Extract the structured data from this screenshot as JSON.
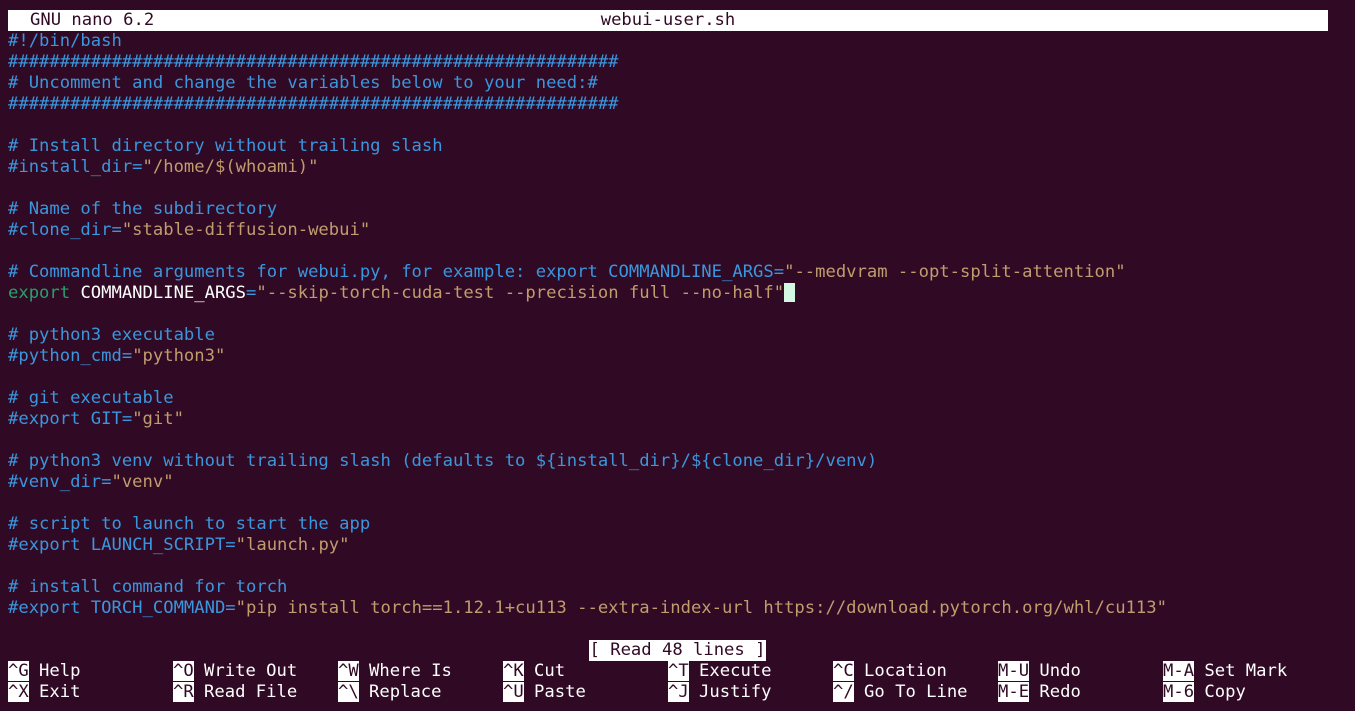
{
  "titlebar": {
    "app": "GNU nano 6.2",
    "filename": "webui-user.sh"
  },
  "editor": {
    "lines": [
      [
        {
          "t": "#!/bin/bash",
          "c": "cm"
        }
      ],
      [
        {
          "t": "###########################################################",
          "c": "cm"
        }
      ],
      [
        {
          "t": "# Uncomment and change the variables below to your need:#",
          "c": "cm"
        }
      ],
      [
        {
          "t": "###########################################################",
          "c": "cm"
        }
      ],
      [],
      [
        {
          "t": "# Install directory without trailing slash",
          "c": "cm"
        }
      ],
      [
        {
          "t": "#install_dir=",
          "c": "cm"
        },
        {
          "t": "\"/home/$(whoami)\"",
          "c": "str"
        }
      ],
      [],
      [
        {
          "t": "# Name of the subdirectory",
          "c": "cm"
        }
      ],
      [
        {
          "t": "#clone_dir=",
          "c": "cm"
        },
        {
          "t": "\"stable-diffusion-webui\"",
          "c": "str"
        }
      ],
      [],
      [
        {
          "t": "# Commandline arguments for webui.py, for example: export COMMANDLINE_ARGS=",
          "c": "cm"
        },
        {
          "t": "\"--medvram --opt-split-attention\"",
          "c": "str"
        }
      ],
      [
        {
          "t": "export",
          "c": "kw"
        },
        {
          "t": " COMMANDLINE_ARGS",
          "c": "pl"
        },
        {
          "t": "=",
          "c": "cm"
        },
        {
          "t": "\"--skip-torch-cuda-test --precision full --no-half\"",
          "c": "str"
        },
        {
          "cursor": true
        }
      ],
      [],
      [
        {
          "t": "# python3 executable",
          "c": "cm"
        }
      ],
      [
        {
          "t": "#python_cmd=",
          "c": "cm"
        },
        {
          "t": "\"python3\"",
          "c": "str"
        }
      ],
      [],
      [
        {
          "t": "# git executable",
          "c": "cm"
        }
      ],
      [
        {
          "t": "#export GIT=",
          "c": "cm"
        },
        {
          "t": "\"git\"",
          "c": "str"
        }
      ],
      [],
      [
        {
          "t": "# python3 venv without trailing slash (defaults to ${install_dir}/${clone_dir}/venv)",
          "c": "cm"
        }
      ],
      [
        {
          "t": "#venv_dir=",
          "c": "cm"
        },
        {
          "t": "\"venv\"",
          "c": "str"
        }
      ],
      [],
      [
        {
          "t": "# script to launch to start the app",
          "c": "cm"
        }
      ],
      [
        {
          "t": "#export LAUNCH_SCRIPT=",
          "c": "cm"
        },
        {
          "t": "\"launch.py\"",
          "c": "str"
        }
      ],
      [],
      [
        {
          "t": "# install command for torch",
          "c": "cm"
        }
      ],
      [
        {
          "t": "#export TORCH_COMMAND=",
          "c": "cm"
        },
        {
          "t": "\"pip install torch==1.12.1+cu113 --extra-index-url https://download.pytorch.org/whl/cu113\"",
          "c": "str"
        }
      ]
    ]
  },
  "status": {
    "message": "[ Read 48 lines ]"
  },
  "shortcuts": [
    {
      "key": "^G",
      "label": "Help"
    },
    {
      "key": "^O",
      "label": "Write Out"
    },
    {
      "key": "^W",
      "label": "Where Is"
    },
    {
      "key": "^K",
      "label": "Cut"
    },
    {
      "key": "^T",
      "label": "Execute"
    },
    {
      "key": "^C",
      "label": "Location"
    },
    {
      "key": "M-U",
      "label": "Undo"
    },
    {
      "key": "M-A",
      "label": "Set Mark"
    },
    {
      "key": "^X",
      "label": "Exit"
    },
    {
      "key": "^R",
      "label": "Read File"
    },
    {
      "key": "^\\",
      "label": "Replace"
    },
    {
      "key": "^U",
      "label": "Paste"
    },
    {
      "key": "^J",
      "label": "Justify"
    },
    {
      "key": "^/",
      "label": "Go To Line"
    },
    {
      "key": "M-E",
      "label": "Redo"
    },
    {
      "key": "M-6",
      "label": "Copy"
    }
  ],
  "colors": {
    "background": "#300a24",
    "comment": "#3a96dd",
    "string": "#c19c6d",
    "keyword": "#27a06b",
    "cursor": "#d4f7e3"
  }
}
